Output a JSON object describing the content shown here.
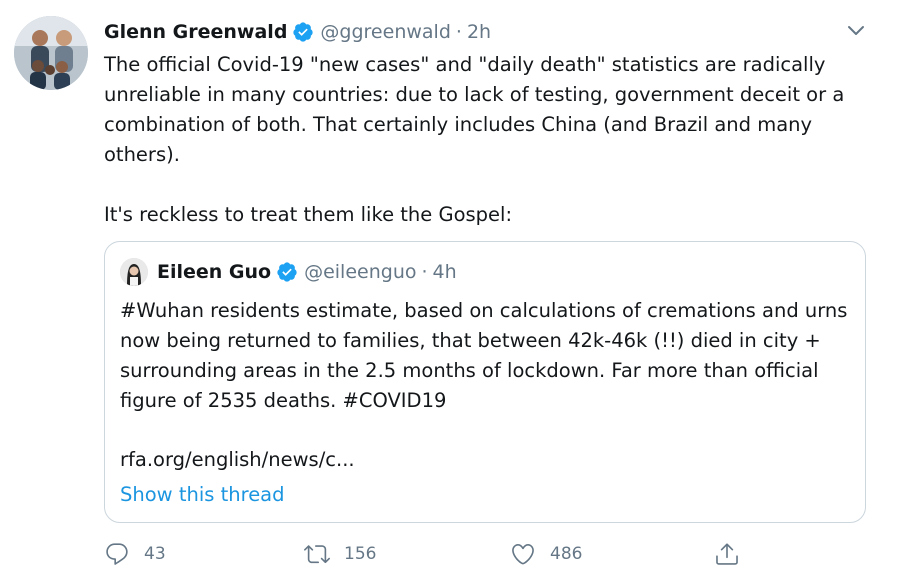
{
  "tweet": {
    "author_name": "Glenn Greenwald",
    "author_handle": "@ggreenwald",
    "separator": "·",
    "time": "2h",
    "text": "The official Covid-19 \"new cases\" and \"daily death\" statistics are radically unreliable in many countries: due to lack of testing, government deceit or a combination of both. That certainly includes China (and Brazil and many others).\n\nIt's reckless to treat them like the Gospel:"
  },
  "quoted": {
    "author_name": "Eileen Guo",
    "author_handle": "@eileenguo",
    "separator": "·",
    "time": "4h",
    "text": "#Wuhan residents estimate, based on calculations of cremations and urns now being returned to families, that between 42k-46k (!!) died in city + surrounding areas in the 2.5 months of lockdown. Far more than official figure of 2535 deaths. #COVID19",
    "link": "rfa.org/english/news/c...",
    "show_thread": "Show this thread"
  },
  "actions": {
    "replies": "43",
    "retweets": "156",
    "likes": "486"
  },
  "icons": {
    "verified": "verified-badge-icon",
    "menu": "chevron-down-icon",
    "reply": "reply-icon",
    "retweet": "retweet-icon",
    "like": "heart-icon",
    "share": "share-icon"
  },
  "colors": {
    "text": "#14171a",
    "secondary": "#657786",
    "link": "#1b95e0",
    "verified": "#1da1f2",
    "border": "#ccd6dd"
  }
}
